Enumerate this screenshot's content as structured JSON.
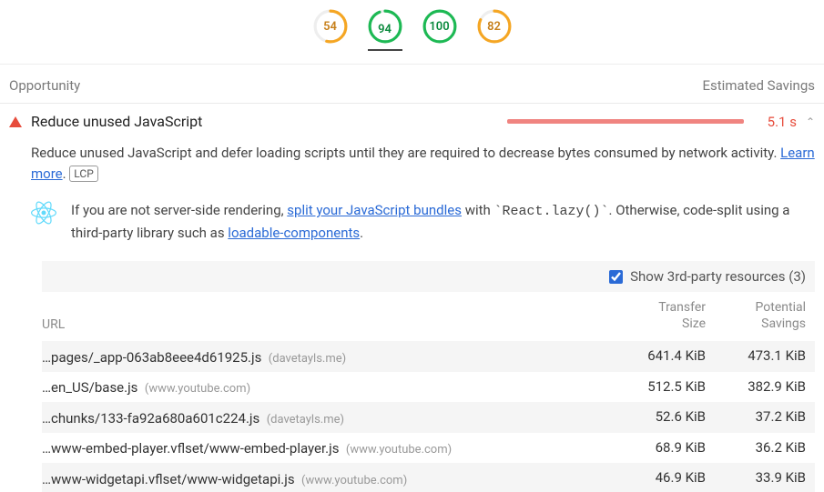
{
  "scores": [
    {
      "value": "54",
      "class": "avg",
      "pct": 54,
      "color": "#f5a623"
    },
    {
      "value": "94",
      "class": "good",
      "pct": 94,
      "color": "#1db954",
      "active": true
    },
    {
      "value": "100",
      "class": "good",
      "pct": 100,
      "color": "#1db954"
    },
    {
      "value": "82",
      "class": "avg",
      "pct": 82,
      "color": "#f5a623"
    }
  ],
  "head": {
    "left": "Opportunity",
    "right": "Estimated Savings"
  },
  "audit": {
    "title": "Reduce unused JavaScript",
    "savings": "5.1 s",
    "desc_a": "Reduce unused JavaScript and defer loading scripts until they are required to decrease bytes consumed by network activity. ",
    "learn_more": "Learn more",
    "lcp": "LCP",
    "tip_a": "If you are not server-side rendering, ",
    "tip_link1": "split your JavaScript bundles",
    "tip_b": " with ",
    "tip_code": "`React.lazy()`",
    "tip_c": ". Otherwise, code-split using a third-party library such as ",
    "tip_link2": "loadable-components",
    "tip_d": "."
  },
  "third_party": {
    "label": "Show 3rd-party resources (3)"
  },
  "columns": {
    "url": "URL",
    "size": "Transfer\nSize",
    "savings": "Potential\nSavings"
  },
  "rows": [
    {
      "url": "…pages/_app-063ab8eee4d61925.js",
      "origin": "(davetayls.me)",
      "size": "641.4 KiB",
      "save": "473.1 KiB"
    },
    {
      "url": "…en_US/base.js",
      "origin": "(www.youtube.com)",
      "size": "512.5 KiB",
      "save": "382.9 KiB"
    },
    {
      "url": "…chunks/133-fa92a680a601c224.js",
      "origin": "(davetayls.me)",
      "size": "52.6 KiB",
      "save": "37.2 KiB"
    },
    {
      "url": "…www-embed-player.vflset/www-embed-player.js",
      "origin": "(www.youtube.com)",
      "size": "68.9 KiB",
      "save": "36.2 KiB"
    },
    {
      "url": "…www-widgetapi.vflset/www-widgetapi.js",
      "origin": "(www.youtube.com)",
      "size": "46.9 KiB",
      "save": "33.9 KiB"
    }
  ]
}
